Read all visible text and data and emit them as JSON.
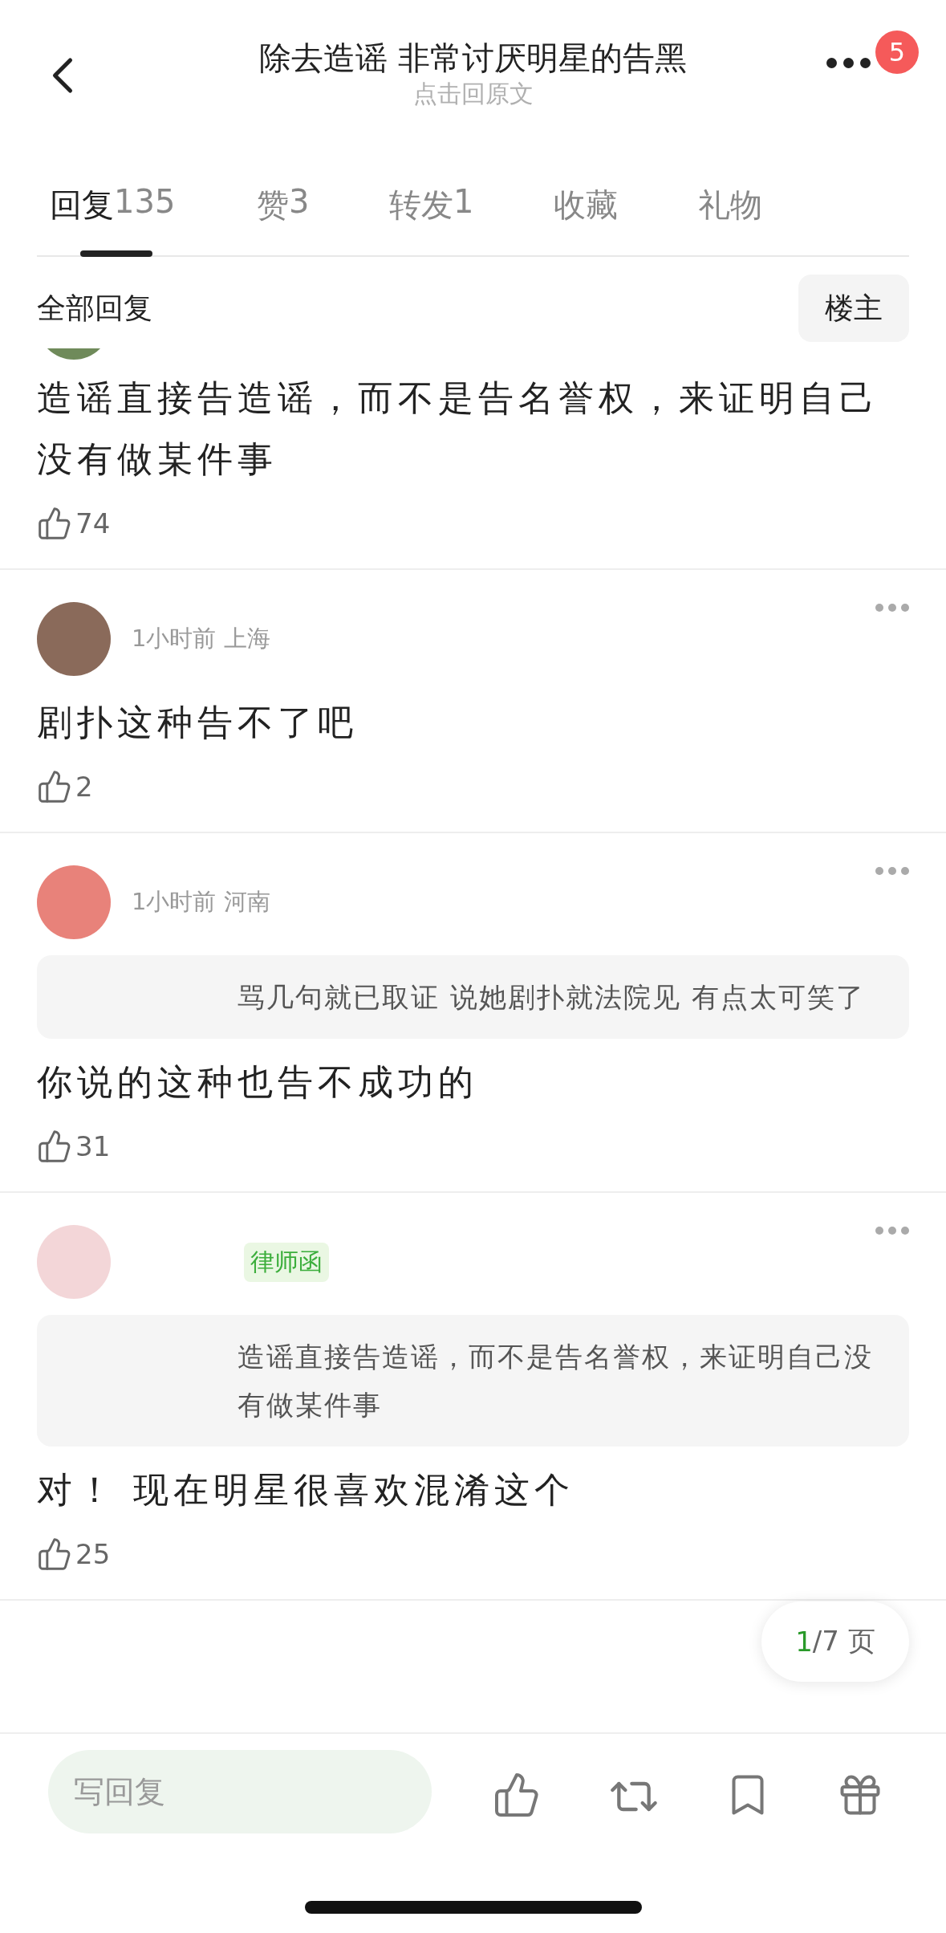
{
  "header": {
    "title": "除去造谣 非常讨厌明星的告黑",
    "subtitle": "点击回原文",
    "notification_count": "5"
  },
  "tabs": [
    {
      "label": "回复",
      "count": "135",
      "selected": true
    },
    {
      "label": "赞",
      "count": "3",
      "selected": false
    },
    {
      "label": "转发",
      "count": "1",
      "selected": false
    },
    {
      "label": "收藏",
      "selected": false
    },
    {
      "label": "礼物",
      "selected": false
    }
  ],
  "filter": {
    "label": "全部回复",
    "author_button": "楼主"
  },
  "comments": [
    {
      "kind": "cut",
      "text": "造谣直接告造谣，而不是告名誉权，来证明自己没有做某件事",
      "likes": "74"
    },
    {
      "kind": "full",
      "meta": "1小时前 上海",
      "text": "剧扑这种告不了吧",
      "likes": "2"
    },
    {
      "kind": "full",
      "meta": "1小时前 河南",
      "quote": "骂几句就已取证 说她剧扑就法院见 有点太可笑了",
      "text": "你说的这种也告不成功的",
      "likes": "31"
    },
    {
      "kind": "full",
      "badge": "律师函",
      "quote": "造谣直接告造谣，而不是告名誉权，来证明自己没有做某件事",
      "text": "对！ 现在明星很喜欢混淆这个",
      "likes": "25"
    }
  ],
  "pager": {
    "current": "1",
    "rest": "/7 页"
  },
  "reply_bar": {
    "placeholder": "写回复"
  }
}
